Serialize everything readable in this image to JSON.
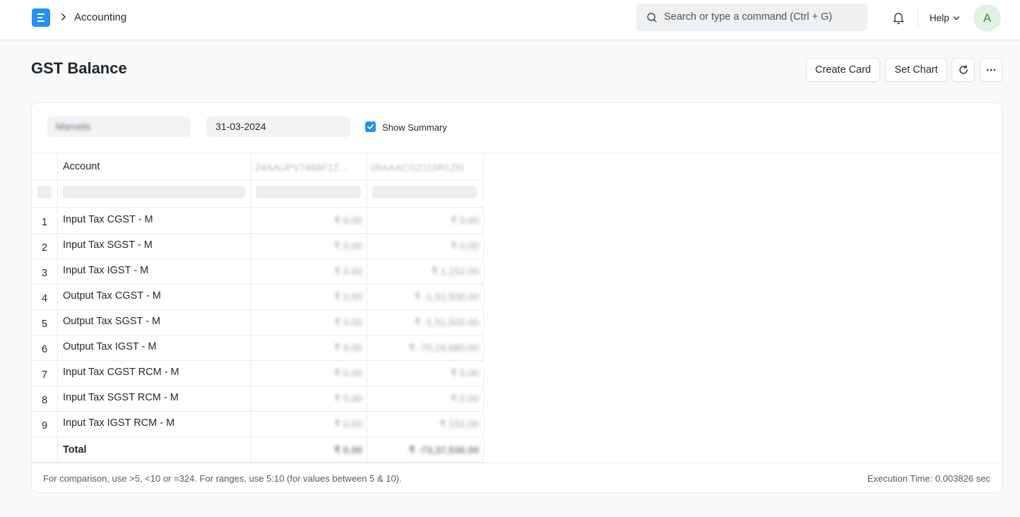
{
  "navbar": {
    "breadcrumb": "Accounting",
    "search_placeholder": "Search or type a command (Ctrl + G)",
    "help_label": "Help",
    "avatar_letter": "A"
  },
  "page": {
    "title": "GST Balance",
    "buttons": {
      "create_card": "Create Card",
      "set_chart": "Set Chart"
    }
  },
  "filters": {
    "company": "Marvels",
    "date": "31-03-2024",
    "show_summary_label": "Show Summary",
    "show_summary_checked": true
  },
  "table": {
    "columns": [
      "Account",
      "24AAUPV7468F1Z...",
      "05AAACG2115R1ZN"
    ],
    "rows": [
      {
        "num": "1",
        "account": "Input Tax CGST - M",
        "c1": "₹ 0.00",
        "c2": "₹ 0.00"
      },
      {
        "num": "2",
        "account": "Input Tax SGST - M",
        "c1": "₹ 0.00",
        "c2": "₹ 0.00"
      },
      {
        "num": "3",
        "account": "Input Tax IGST - M",
        "c1": "₹ 0.00",
        "c2": "₹ 1,152.00"
      },
      {
        "num": "4",
        "account": "Output Tax CGST - M",
        "c1": "₹ 0.00",
        "c2": "₹ -1,51,500.00"
      },
      {
        "num": "5",
        "account": "Output Tax SGST - M",
        "c1": "₹ 0.00",
        "c2": "₹ -1,51,500.00"
      },
      {
        "num": "6",
        "account": "Output Tax IGST - M",
        "c1": "₹ 0.00",
        "c2": "₹ -70,24,680.00"
      },
      {
        "num": "7",
        "account": "Input Tax CGST RCM - M",
        "c1": "₹ 0.00",
        "c2": "₹ 0.00"
      },
      {
        "num": "8",
        "account": "Input Tax SGST RCM - M",
        "c1": "₹ 0.00",
        "c2": "₹ 0.00"
      },
      {
        "num": "9",
        "account": "Input Tax IGST RCM - M",
        "c1": "₹ 0.00",
        "c2": "₹ 152.00"
      }
    ],
    "total": {
      "label": "Total",
      "c1": "₹ 0.00",
      "c2": "₹ -73,37,530.00"
    }
  },
  "footer": {
    "hint": "For comparison, use >5, <10 or =324. For ranges, use 5:10 (for values between 5 & 10).",
    "execution_time": "Execution Time: 0.003826 sec"
  },
  "colors": {
    "primary": "#2490ef",
    "avatar_bg": "#e3f1e5",
    "avatar_fg": "#3d8d4f"
  },
  "icons": [
    "app-logo-icon",
    "chevron-right-icon",
    "search-icon",
    "bell-icon",
    "chevron-down-icon",
    "refresh-icon",
    "more-icon",
    "checkmark-icon"
  ]
}
